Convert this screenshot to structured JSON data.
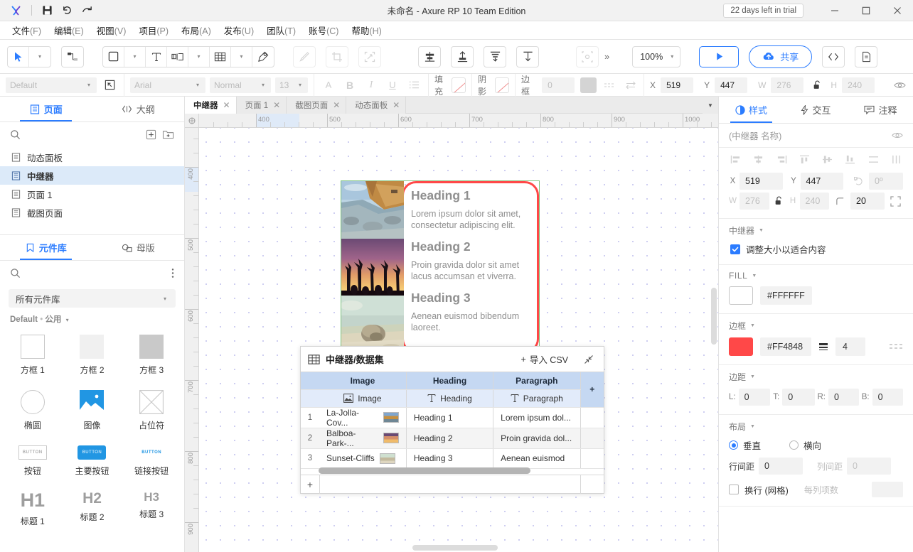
{
  "titlebar": {
    "app_icon": "axure-x-icon",
    "save_icon": "save-icon",
    "undo_icon": "undo-icon",
    "redo_icon": "redo-icon",
    "title": "未命名 - Axure RP 10 Team Edition",
    "trial_badge": "22 days left in trial",
    "minimize": "minimize-icon",
    "maximize": "maximize-icon",
    "close": "close-icon"
  },
  "menubar": {
    "items": [
      {
        "label": "文件",
        "mnemonic": "(F)"
      },
      {
        "label": "编辑",
        "mnemonic": "(E)"
      },
      {
        "label": "视图",
        "mnemonic": "(V)"
      },
      {
        "label": "项目",
        "mnemonic": "(P)"
      },
      {
        "label": "布局",
        "mnemonic": "(A)"
      },
      {
        "label": "发布",
        "mnemonic": "(U)"
      },
      {
        "label": "团队",
        "mnemonic": "(T)"
      },
      {
        "label": "账号",
        "mnemonic": "(C)"
      },
      {
        "label": "帮助",
        "mnemonic": "(H)"
      }
    ]
  },
  "toolbar": {
    "zoom_value": "100%",
    "share_label": "共享",
    "overflow_label": "»",
    "tools": [
      "select-tool-icon",
      "connector-tool-icon",
      "rectangle-tool-icon",
      "text-tool-icon",
      "snapshot-tool-icon",
      "table-tool-icon",
      "pen-tool-icon",
      "format-painter-icon",
      "crop-icon",
      "transform-icon",
      "align-group-icon",
      "align-vertical-icon",
      "distribute-icon",
      "bring-front-icon",
      "group-icon"
    ],
    "play_icon": "preview-play-icon",
    "cloud_icon": "cloud-upload-icon",
    "code_icon": "code-icon",
    "doc_icon": "document-icon"
  },
  "propbar": {
    "style_preset": "Default",
    "pick_icon": "style-picker-icon",
    "font_family": "Arial",
    "font_weight": "Normal",
    "font_size": "13",
    "font_color_icon": "A",
    "bold_icon": "B",
    "italic_icon": "I",
    "underline_icon": "U",
    "list_icon": "bullet-list-icon",
    "fill_label": "填充",
    "shadow_label": "阴影",
    "border_label": "边框",
    "border_value": "0",
    "x_label": "X",
    "x_value": "519",
    "y_label": "Y",
    "y_value": "447",
    "w_label": "W",
    "w_value": "276",
    "h_label": "H",
    "h_value": "240",
    "lock_icon": "unlock-icon",
    "eye_icon": "visibility-icon",
    "more_icon": "»"
  },
  "left_panel": {
    "tabs": [
      {
        "label": "页面",
        "icon": "pages-icon",
        "active": true
      },
      {
        "label": "大纲",
        "icon": "outline-icon",
        "active": false
      }
    ],
    "search_icon": "search-icon",
    "add_page_icon": "add-page-icon",
    "add_folder_icon": "add-folder-icon",
    "pages": [
      {
        "label": "动态面板",
        "selected": false
      },
      {
        "label": "中继器",
        "selected": true
      },
      {
        "label": "页面 1",
        "selected": false
      },
      {
        "label": "截图页面",
        "selected": false
      }
    ],
    "lib_tabs": [
      {
        "label": "元件库",
        "icon": "library-icon",
        "active": true
      },
      {
        "label": "母版",
        "icon": "masters-icon",
        "active": false
      }
    ],
    "lib_search_icon": "search-icon",
    "lib_more_icon": "more-vertical-icon",
    "lib_select": "所有元件库",
    "lib_breadcrumb_name": "Default",
    "lib_breadcrumb_sep": "•",
    "lib_breadcrumb_group": "公用",
    "widgets": [
      {
        "label": "方框 1",
        "icon": "box1-icon"
      },
      {
        "label": "方框 2",
        "icon": "box2-icon"
      },
      {
        "label": "方框 3",
        "icon": "box3-icon"
      },
      {
        "label": "椭圆",
        "icon": "ellipse-icon"
      },
      {
        "label": "图像",
        "icon": "image-icon"
      },
      {
        "label": "占位符",
        "icon": "placeholder-icon"
      },
      {
        "label": "按钮",
        "icon": "button-icon",
        "badge": "BUTTON"
      },
      {
        "label": "主要按钮",
        "icon": "primary-button-icon",
        "badge": "BUTTON"
      },
      {
        "label": "链接按钮",
        "icon": "link-button-icon",
        "badge": "BUTTON"
      },
      {
        "label": "标题 1",
        "icon": "h1-icon",
        "badge": "H1"
      },
      {
        "label": "标题 2",
        "icon": "h2-icon",
        "badge": "H2"
      },
      {
        "label": "标题 3",
        "icon": "h3-icon",
        "badge": "H3"
      }
    ]
  },
  "page_tabs": [
    {
      "label": "中继器",
      "active": true
    },
    {
      "label": "页面 1",
      "active": false
    },
    {
      "label": "截图页面",
      "active": false
    },
    {
      "label": "动态面板",
      "active": false
    }
  ],
  "canvas": {
    "ruler_h_labels": [
      "400",
      "500",
      "600",
      "700",
      "800",
      "900",
      "1000"
    ],
    "ruler_v_labels": [
      "400",
      "500",
      "600",
      "700",
      "800",
      "900"
    ],
    "repeater_items": [
      {
        "heading": "Heading 1",
        "paragraph": "Lorem ipsum dolor sit amet, consectetur adipiscing elit.",
        "image": "la-jolla-cove-photo"
      },
      {
        "heading": "Heading 2",
        "paragraph": "Proin gravida dolor sit amet lacus accumsan et viverra.",
        "image": "balboa-park-photo"
      },
      {
        "heading": "Heading 3",
        "paragraph": "Aenean euismod bibendum laoreet.",
        "image": "sunset-cliffs-photo"
      }
    ]
  },
  "datagrid": {
    "icon": "grid-icon",
    "title": "中继器/数据集",
    "import_label": "导入 CSV",
    "import_plus": "+",
    "collapse_icon": "collapse-icon",
    "add_column_label": "+",
    "add_row_label": "+",
    "columns": [
      {
        "name": "Image",
        "type_label": "Image",
        "type_icon": "image-cell-icon"
      },
      {
        "name": "Heading",
        "type_label": "Heading",
        "type_icon": "text-cell-icon"
      },
      {
        "name": "Paragraph",
        "type_label": "Paragraph",
        "type_icon": "text-cell-icon"
      }
    ],
    "rows": [
      {
        "n": "1",
        "image": "La-Jolla-Cov...",
        "heading": "Heading 1",
        "paragraph": "Lorem ipsum dol..."
      },
      {
        "n": "2",
        "image": "Balboa-Park-...",
        "heading": "Heading 2",
        "paragraph": "Proin gravida dol..."
      },
      {
        "n": "3",
        "image": "Sunset-Cliffs",
        "heading": "Heading 3",
        "paragraph": "Aenean euismod"
      }
    ]
  },
  "right_panel": {
    "tabs": [
      {
        "label": "样式",
        "icon": "style-icon",
        "active": true
      },
      {
        "label": "交互",
        "icon": "interaction-icon",
        "active": false
      },
      {
        "label": "注释",
        "icon": "notes-icon",
        "active": false
      }
    ],
    "name_placeholder": "(中继器 名称)",
    "eye_icon": "visibility-icon",
    "x_label": "X",
    "x_value": "519",
    "y_label": "Y",
    "y_value": "447",
    "rotation_label": "rotation-icon",
    "rotation_value": "0º",
    "w_label": "W",
    "w_value": "276",
    "h_label": "H",
    "h_value": "240",
    "lock_icon": "unlock-icon",
    "corner_label": "corner-radius-icon",
    "corner_value": "20",
    "corner_more_icon": "corner-sides-icon",
    "repeater_section": "中继器",
    "fit_content_label": "调整大小以适合内容",
    "fit_content_checked": true,
    "fill_section": "FILL",
    "fill_hex": "#FFFFFF",
    "border_section": "边框",
    "border_hex": "#FF4848",
    "border_width": "4",
    "border_stroke_icon": "stroke-weight-icon",
    "border_dash_icon": "dash-style-icon",
    "padding_section": "边距",
    "padding": [
      {
        "label": "L:",
        "value": "0"
      },
      {
        "label": "T:",
        "value": "0"
      },
      {
        "label": "R:",
        "value": "0"
      },
      {
        "label": "B:",
        "value": "0"
      }
    ],
    "layout_section": "布局",
    "layout_vertical": "垂直",
    "layout_horizontal": "横向",
    "layout_vertical_selected": true,
    "row_gap_label": "行间距",
    "row_gap_value": "0",
    "col_gap_label": "列间距",
    "col_gap_value": "0",
    "wrap_label": "换行 (网格)",
    "wrap_checked": false,
    "items_per_col_label": "每列项数"
  }
}
